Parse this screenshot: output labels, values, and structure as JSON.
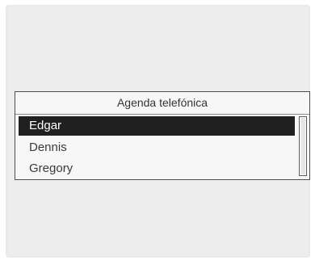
{
  "phonebook": {
    "title": "Agenda telefónica",
    "contacts": [
      {
        "name": "Edgar",
        "selected": true
      },
      {
        "name": "Dennis",
        "selected": false
      },
      {
        "name": "Gregory",
        "selected": false
      }
    ]
  }
}
